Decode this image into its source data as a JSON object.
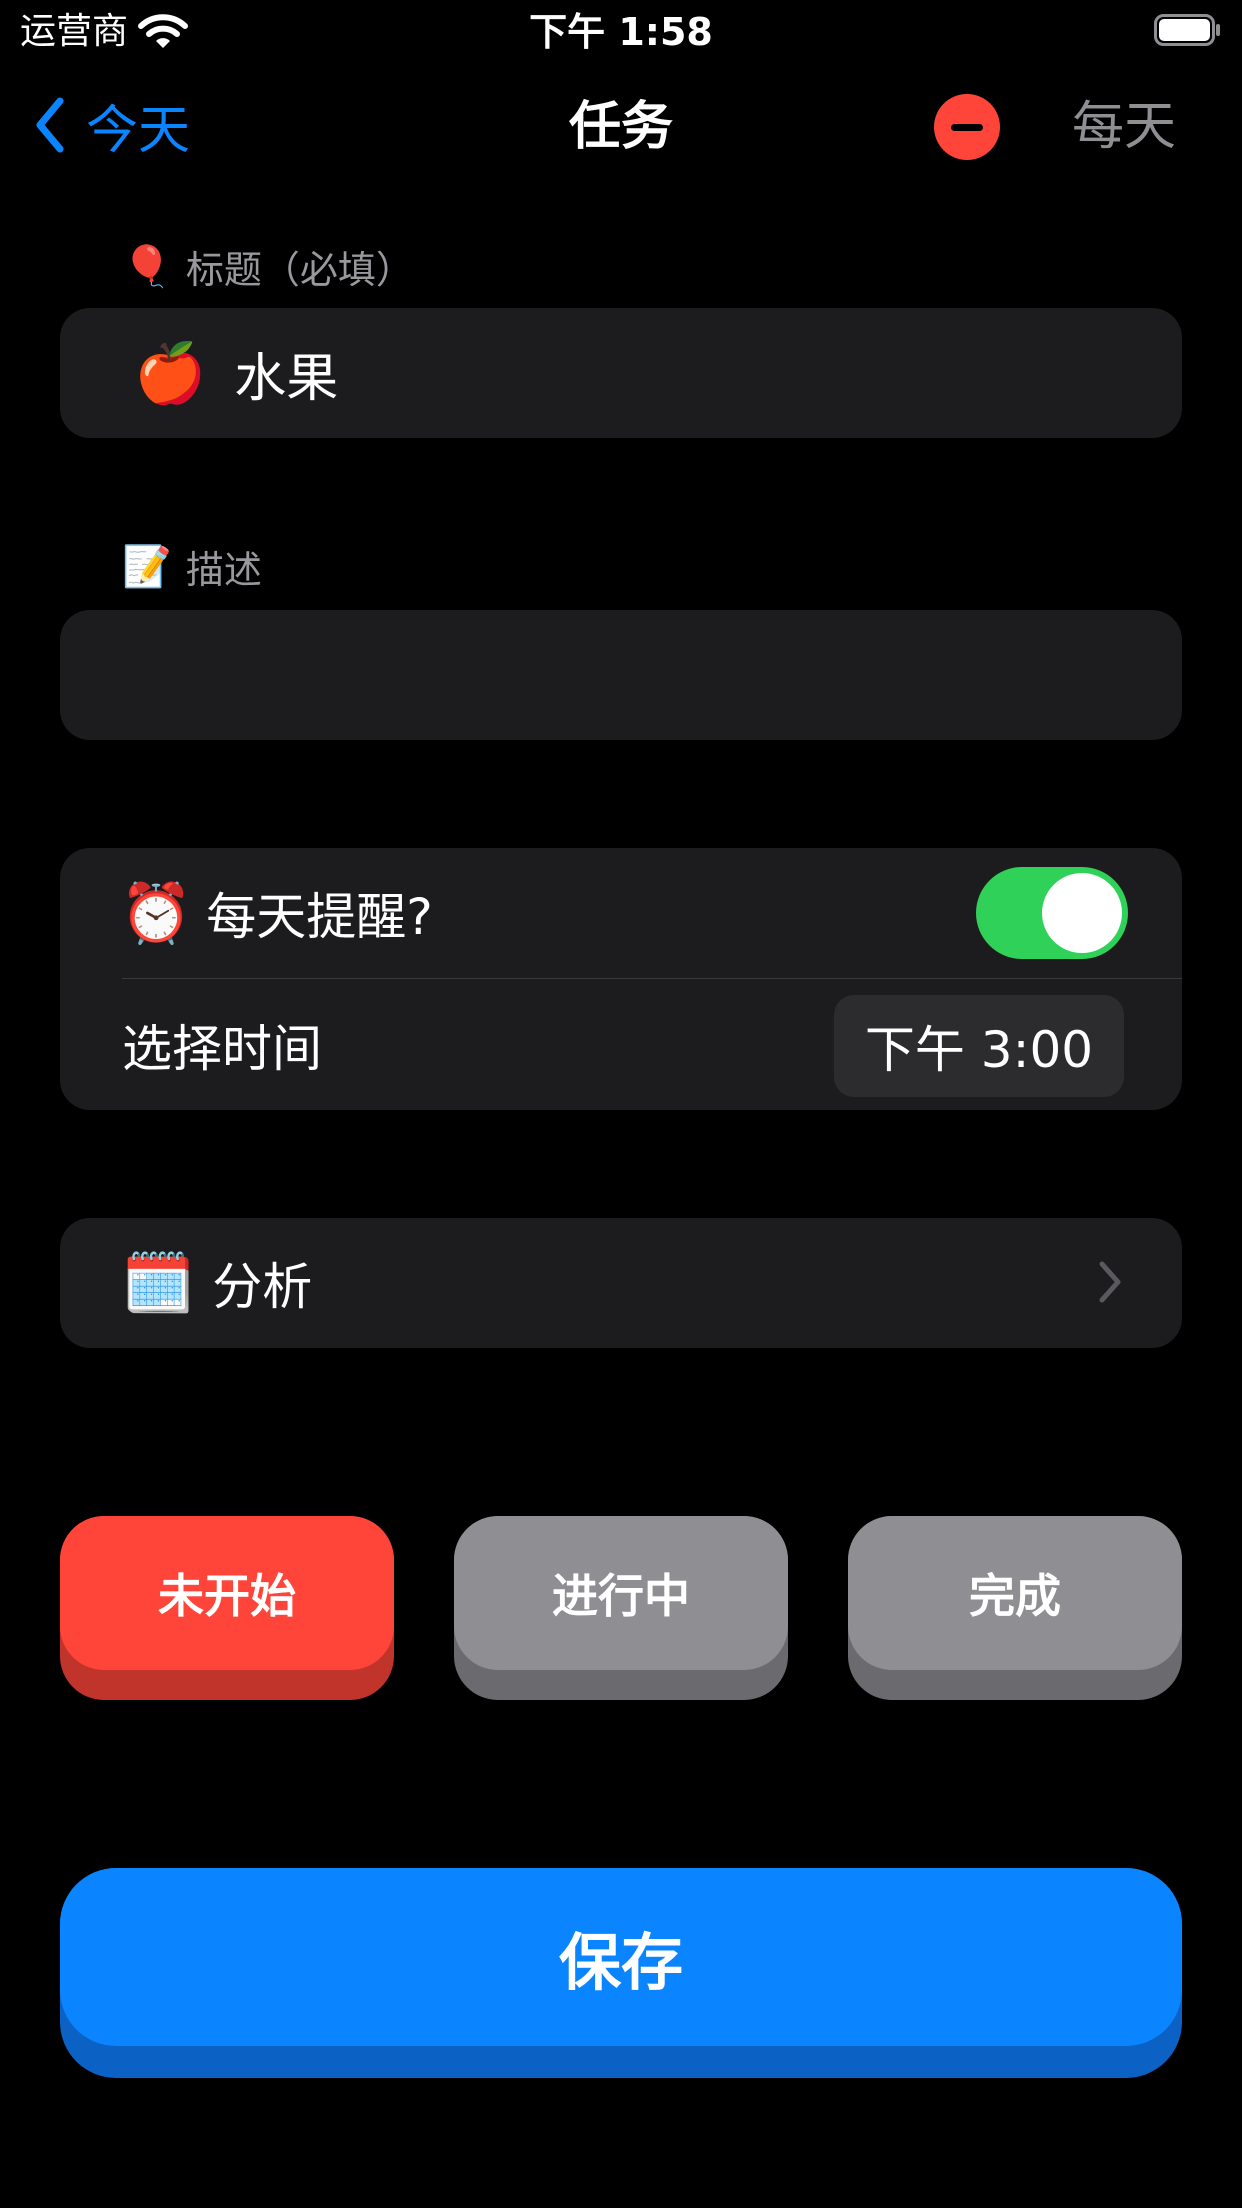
{
  "status_bar": {
    "carrier": "运营商",
    "time": "下午 1:58"
  },
  "nav": {
    "back_label": "今天",
    "title": "任务",
    "right_label": "每天"
  },
  "title_section": {
    "label_emoji": "🎈",
    "label": "标题（必填）",
    "value_emoji": "🍎",
    "value": "水果"
  },
  "description_section": {
    "label_emoji": "📝",
    "label": "描述",
    "value": ""
  },
  "reminder": {
    "emoji": "⏰",
    "label": "每天提醒?",
    "enabled": true,
    "time_label": "选择时间",
    "time_value": "下午 3:00"
  },
  "analysis": {
    "emoji": "🗓️",
    "label": "分析"
  },
  "status_buttons": {
    "not_started": "未开始",
    "in_progress": "进行中",
    "done": "完成"
  },
  "save_label": "保存",
  "colors": {
    "accent": "#0a84ff",
    "danger": "#ff453a",
    "toggle_on": "#30d158",
    "inactive": "#8e8e93"
  }
}
